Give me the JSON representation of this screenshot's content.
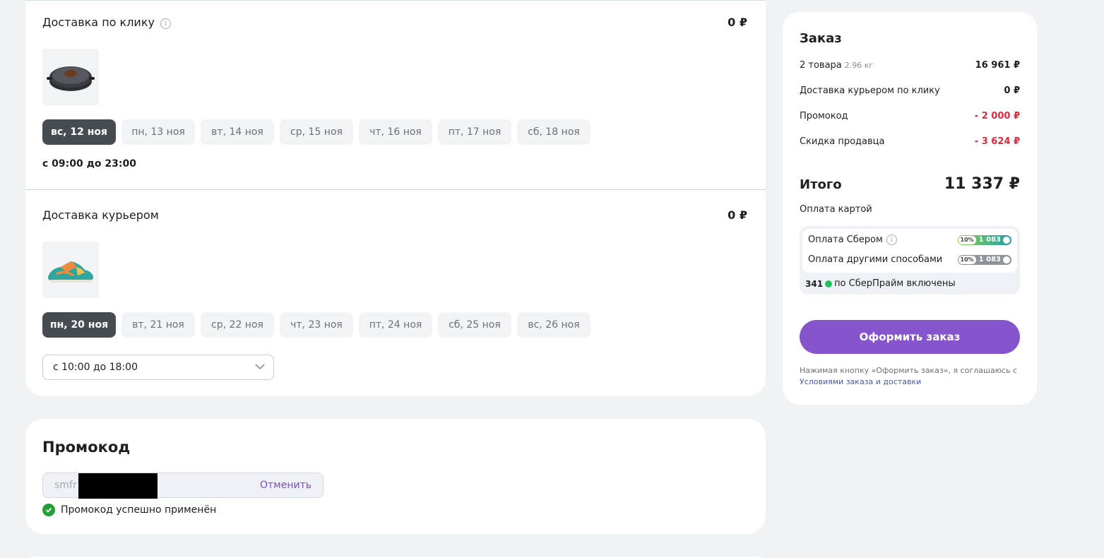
{
  "delivery_click": {
    "title": "Доставка по клику",
    "price": "0 ₽",
    "days": [
      "вс, 12 ноя",
      "пн, 13 ноя",
      "вт, 14 ноя",
      "ср, 15 ноя",
      "чт, 16 ноя",
      "пт, 17 ноя",
      "сб, 18 ноя"
    ],
    "time": "с 09:00 до 23:00"
  },
  "delivery_courier": {
    "title": "Доставка курьером",
    "price": "0 ₽",
    "days": [
      "пн, 20 ноя",
      "вт, 21 ноя",
      "ср, 22 ноя",
      "чт, 23 ноя",
      "пт, 24 ноя",
      "сб, 25 ноя",
      "вс, 26 ноя"
    ],
    "time_select": "с 10:00 до 18:00"
  },
  "promo": {
    "title": "Промокод",
    "value": "smfr",
    "cancel": "Отменить",
    "status": "Промокод успешно применён"
  },
  "order": {
    "title": "Заказ",
    "items_label": "2 товара",
    "items_weight": "2.96 кг",
    "items_price": "16 961 ₽",
    "delivery_label": "Доставка курьером по клику",
    "delivery_price": "0 ₽",
    "promo_label": "Промокод",
    "promo_value": "- 2 000 ₽",
    "seller_label": "Скидка продавца",
    "seller_value": "- 3 624 ₽",
    "total_label": "Итого",
    "total_value": "11 337 ₽",
    "payment_type": "Оплата картой",
    "bonus": {
      "sber_label": "Оплата Сбером",
      "sber_pct": "10%",
      "sber_amount": "1 083",
      "other_label": "Оплата другими способами",
      "other_pct": "10%",
      "other_amount": "1 083",
      "prime_amount": "341",
      "prime_text": "по СберПрайм включены"
    },
    "button": "Оформить заказ",
    "legal_text": "Нажимая кнопку «Оформить заказ», я соглашаюсь с ",
    "legal_link": "Условиями заказа и доставки"
  },
  "colors": {
    "accent": "#8654cc",
    "negative": "#e0293c",
    "active_day": "#474c53",
    "success": "#21a038"
  }
}
